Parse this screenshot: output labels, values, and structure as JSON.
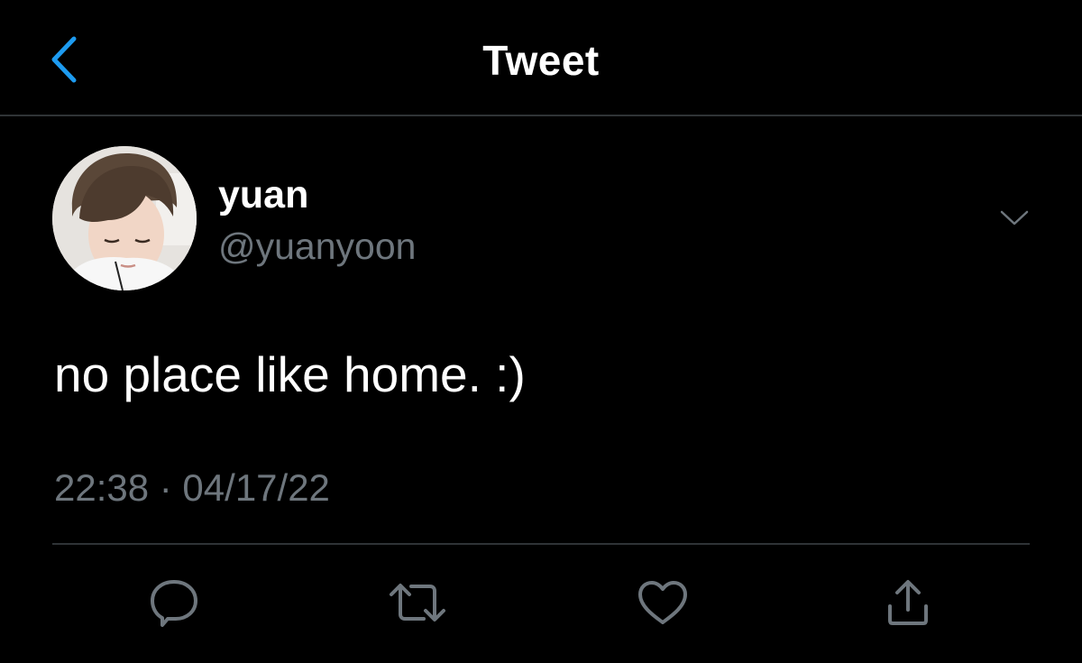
{
  "header": {
    "title": "Tweet",
    "back_icon": "chevron-left-icon"
  },
  "tweet": {
    "author": {
      "display_name": "yuan",
      "handle": "@yuanyoon",
      "avatar": "avatar-photo"
    },
    "text": "no place like home. :)",
    "timestamp": "22:38 · 04/17/22",
    "more_icon": "chevron-down-icon"
  },
  "actions": [
    {
      "icon": "reply-icon"
    },
    {
      "icon": "retweet-icon"
    },
    {
      "icon": "like-icon"
    },
    {
      "icon": "share-icon"
    }
  ],
  "colors": {
    "background": "#000000",
    "accent": "#1d9bf0",
    "primary_text": "#ffffff",
    "secondary_text": "#6e767d",
    "divider": "#2f3336"
  }
}
